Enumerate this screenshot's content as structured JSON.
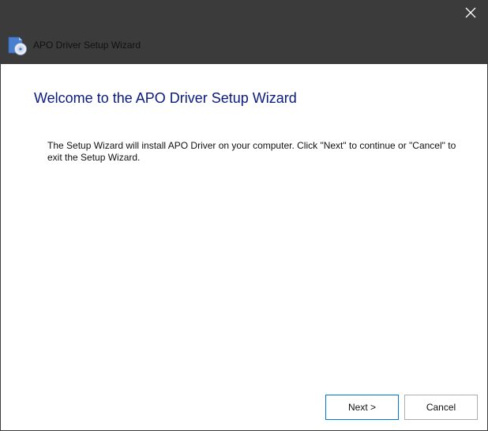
{
  "window": {
    "title": "APO Driver Setup Wizard"
  },
  "icons": {
    "app": "setup-disc-icon",
    "close": "close-icon"
  },
  "main": {
    "heading": "Welcome to the APO Driver Setup Wizard",
    "body": "The Setup Wizard will install APO Driver on your computer.  Click \"Next\" to continue or \"Cancel\" to exit the Setup Wizard."
  },
  "buttons": {
    "next_label": "Next >",
    "cancel_label": "Cancel"
  },
  "colors": {
    "titlebar": "#3b3b3b",
    "heading": "#0a1a7f",
    "focus_border": "#0078d7"
  }
}
